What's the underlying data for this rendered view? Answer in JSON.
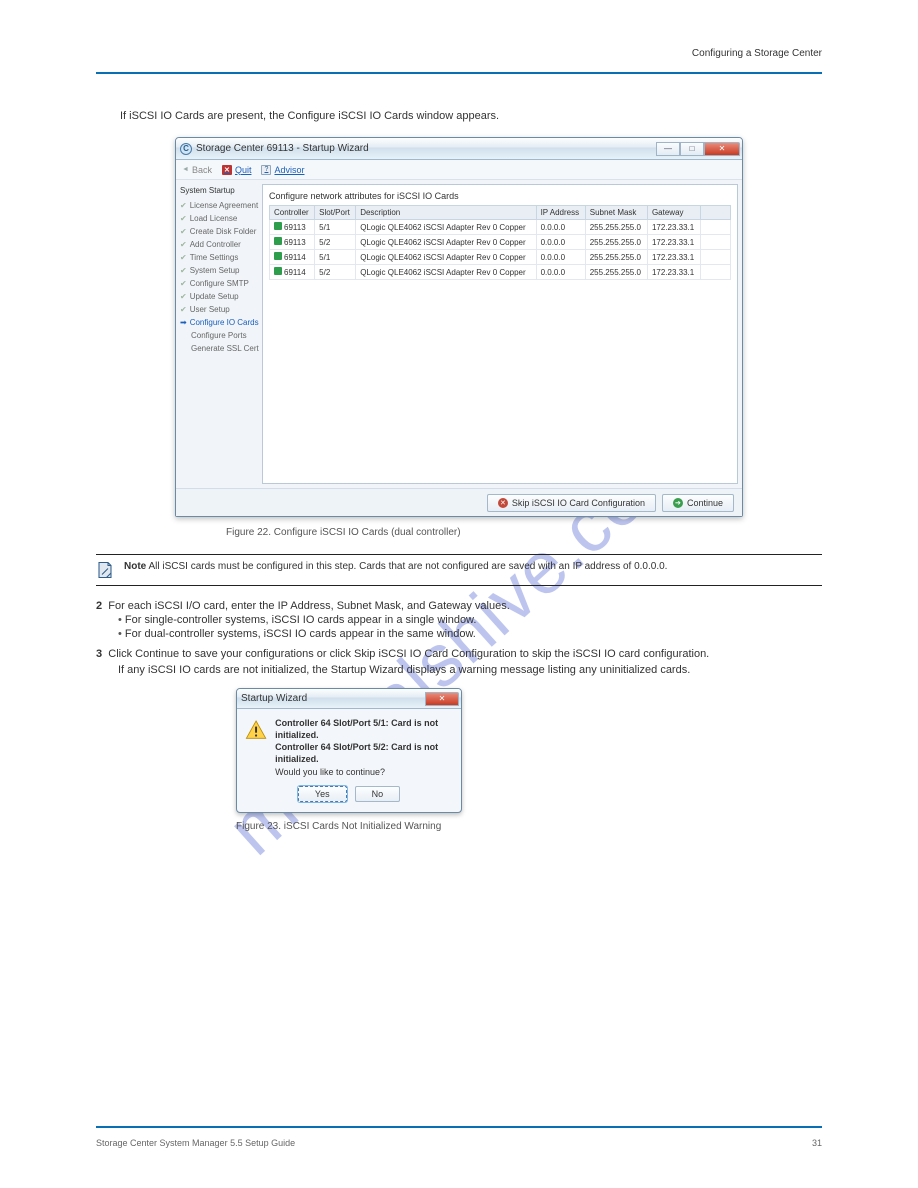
{
  "watermark": "manualshive.com",
  "page": {
    "header_right": "Configuring a Storage Center",
    "footer_left": "Storage Center System Manager 5.5 Setup Guide",
    "footer_page": "31"
  },
  "intro": "If iSCSI IO Cards are present, the Configure iSCSI IO Cards window appears.",
  "window1": {
    "title": "Storage Center 69113 - Startup Wizard",
    "toolbar": {
      "back": "Back",
      "quit": "Quit",
      "advisor": "Advisor"
    },
    "sidebar": {
      "heading": "System Startup",
      "items": [
        {
          "label": "License Agreement",
          "state": "done"
        },
        {
          "label": "Load License",
          "state": "done"
        },
        {
          "label": "Create Disk Folder",
          "state": "done"
        },
        {
          "label": "Add Controller",
          "state": "done"
        },
        {
          "label": "Time Settings",
          "state": "done"
        },
        {
          "label": "System Setup",
          "state": "done"
        },
        {
          "label": "Configure SMTP",
          "state": "done"
        },
        {
          "label": "Update Setup",
          "state": "done"
        },
        {
          "label": "User Setup",
          "state": "done"
        },
        {
          "label": "Configure IO Cards",
          "state": "current"
        },
        {
          "label": "Configure Ports",
          "state": "plain"
        },
        {
          "label": "Generate SSL Cert",
          "state": "plain"
        }
      ]
    },
    "main_heading": "Configure network attributes for iSCSI IO Cards",
    "columns": [
      "Controller",
      "Slot/Port",
      "Description",
      "IP Address",
      "Subnet Mask",
      "Gateway"
    ],
    "rows": [
      {
        "controller": "69113",
        "slot": "5/1",
        "desc": "QLogic QLE4062 iSCSI Adapter Rev 0 Copper",
        "ip": "0.0.0.0",
        "mask": "255.255.255.0",
        "gw": "172.23.33.1"
      },
      {
        "controller": "69113",
        "slot": "5/2",
        "desc": "QLogic QLE4062 iSCSI Adapter Rev 0 Copper",
        "ip": "0.0.0.0",
        "mask": "255.255.255.0",
        "gw": "172.23.33.1"
      },
      {
        "controller": "69114",
        "slot": "5/1",
        "desc": "QLogic QLE4062 iSCSI Adapter Rev 0 Copper",
        "ip": "0.0.0.0",
        "mask": "255.255.255.0",
        "gw": "172.23.33.1"
      },
      {
        "controller": "69114",
        "slot": "5/2",
        "desc": "QLogic QLE4062 iSCSI Adapter Rev 0 Copper",
        "ip": "0.0.0.0",
        "mask": "255.255.255.0",
        "gw": "172.23.33.1"
      }
    ],
    "buttons": {
      "skip": "Skip iSCSI IO Card Configuration",
      "continue": "Continue"
    }
  },
  "figure1": "Figure 22. Configure iSCSI IO Cards (dual controller)",
  "note": {
    "label": "Note",
    "text": "All iSCSI cards must be configured in this step. Cards that are not configured are saved with an IP address of 0.0.0.0."
  },
  "step2": {
    "num": "2",
    "lead": "For each iSCSI I/O card, enter the IP Address, Subnet Mask, and Gateway values.",
    "bullets": [
      "For single-controller systems, iSCSI IO cards appear in a single window.",
      "For dual-controller systems, iSCSI IO cards appear in the same window."
    ]
  },
  "step3": {
    "num": "3",
    "lead": "Click Continue to save your configurations or click Skip iSCSI IO Card Configuration to skip the iSCSI IO card configuration.",
    "parag": "If any iSCSI IO cards are not initialized, the Startup Wizard displays a warning message listing any uninitialized cards."
  },
  "dialog": {
    "title": "Startup Wizard",
    "lines": [
      "Controller 64 Slot/Port 5/1: Card is not initialized.",
      "Controller 64 Slot/Port 5/2: Card is not initialized.",
      "Would you like to continue?"
    ],
    "yes": "Yes",
    "no": "No"
  },
  "figure2": "Figure 23. iSCSI Cards Not Initialized Warning"
}
